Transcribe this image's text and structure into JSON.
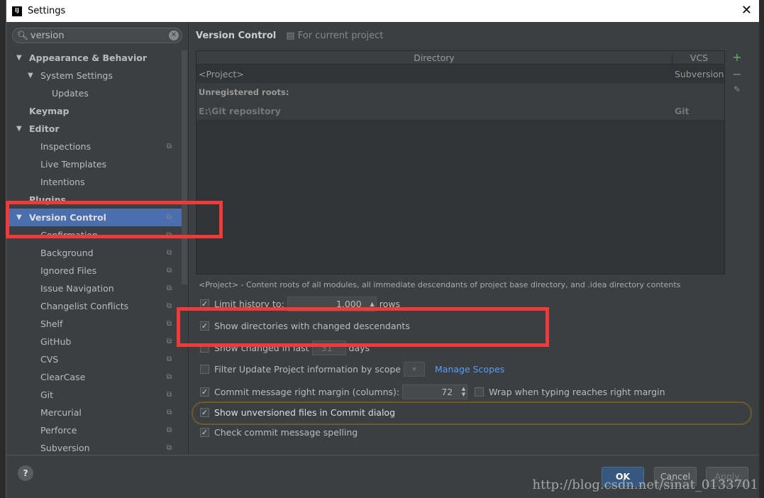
{
  "window": {
    "title": "Settings"
  },
  "search": {
    "value": "version"
  },
  "tree": [
    {
      "label": "Appearance & Behavior",
      "level": 0,
      "arrow": true,
      "bold": true
    },
    {
      "label": "System Settings",
      "level": 1,
      "arrow": true
    },
    {
      "label": "Updates",
      "level": 2
    },
    {
      "label": "Keymap",
      "level": 0,
      "bold": true
    },
    {
      "label": "Editor",
      "level": 0,
      "arrow": true,
      "bold": true
    },
    {
      "label": "Inspections",
      "level": 1,
      "copy": true
    },
    {
      "label": "Live Templates",
      "level": 1
    },
    {
      "label": "Intentions",
      "level": 1
    },
    {
      "label": "Plugins",
      "level": 0,
      "bold": true
    },
    {
      "label": "Version Control",
      "level": 0,
      "arrow": true,
      "bold": true,
      "selected": true,
      "copy": true
    },
    {
      "label": "Confirmation",
      "level": 1,
      "copy": true
    },
    {
      "label": "Background",
      "level": 1,
      "copy": true
    },
    {
      "label": "Ignored Files",
      "level": 1,
      "copy": true
    },
    {
      "label": "Issue Navigation",
      "level": 1,
      "copy": true
    },
    {
      "label": "Changelist Conflicts",
      "level": 1,
      "copy": true
    },
    {
      "label": "Shelf",
      "level": 1,
      "copy": true
    },
    {
      "label": "GitHub",
      "level": 1,
      "copy": true
    },
    {
      "label": "CVS",
      "level": 1,
      "copy": true
    },
    {
      "label": "ClearCase",
      "level": 1,
      "copy": true
    },
    {
      "label": "Git",
      "level": 1,
      "copy": true
    },
    {
      "label": "Mercurial",
      "level": 1,
      "copy": true
    },
    {
      "label": "Perforce",
      "level": 1,
      "copy": true
    },
    {
      "label": "Subversion",
      "level": 1,
      "copy": true
    }
  ],
  "main": {
    "title": "Version Control",
    "scope": "For current project",
    "columns": [
      "Directory",
      "VCS"
    ],
    "rows": [
      [
        "<Project>",
        "Subversion"
      ],
      [
        "Unregistered roots:",
        ""
      ],
      [
        "E:\\Git repository",
        "Git"
      ]
    ],
    "note": "<Project> - Content roots of all modules, all immediate descendants of project base directory, and .idea directory contents",
    "limit_history": {
      "label": "Limit history to:",
      "value": "1,000",
      "suffix": "rows",
      "checked": true
    },
    "show_dirs": {
      "label": "Show directories with changed descendants",
      "checked": true
    },
    "show_changed": {
      "label": "Show changed in last",
      "value": "31",
      "suffix": "days",
      "checked": false
    },
    "filter_scope": {
      "label": "Filter Update Project information by scope",
      "checked": false,
      "link": "Manage Scopes"
    },
    "commit_margin": {
      "label": "Commit message right margin (columns):",
      "value": "72",
      "checked": true
    },
    "wrap": {
      "label": "Wrap when typing reaches right margin",
      "checked": false
    },
    "unversioned": {
      "label": "Show unversioned files in Commit dialog",
      "checked": true
    },
    "spelling": {
      "label": "Check commit message spelling",
      "checked": true
    }
  },
  "buttons": {
    "ok": "OK",
    "cancel": "Cancel",
    "apply": "Apply",
    "help": "?"
  },
  "watermark": "http://blog.csdn.net/sinat_0133701"
}
